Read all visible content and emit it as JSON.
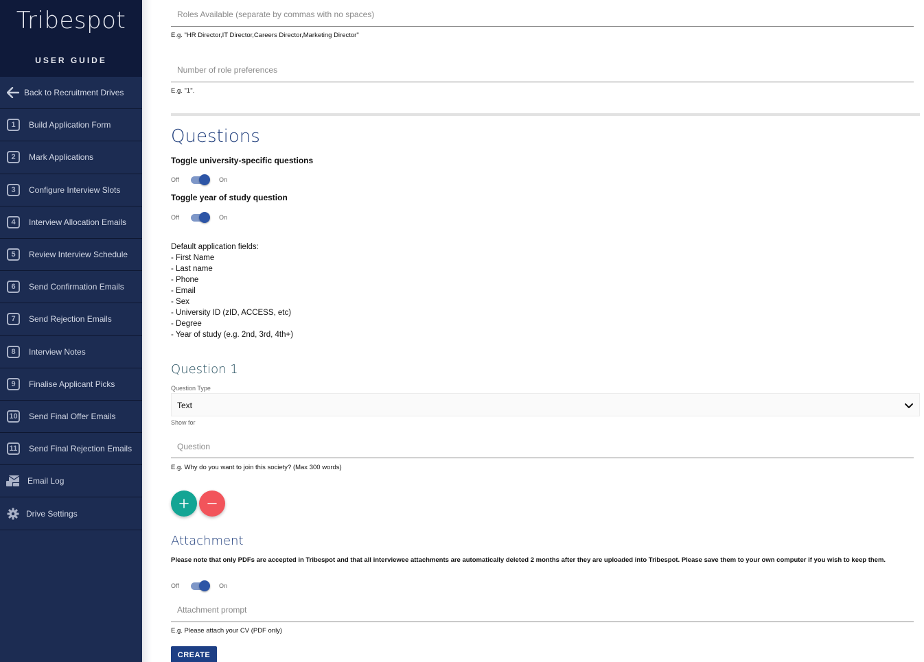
{
  "sidebar": {
    "logo": "Tribespot",
    "subtitle": "USER GUIDE",
    "back_label": "Back to Recruitment Drives",
    "items": [
      {
        "num": "1",
        "label": "Build Application Form"
      },
      {
        "num": "2",
        "label": "Mark Applications"
      },
      {
        "num": "3",
        "label": "Configure Interview Slots"
      },
      {
        "num": "4",
        "label": "Interview Allocation Emails"
      },
      {
        "num": "5",
        "label": "Review Interview Schedule"
      },
      {
        "num": "6",
        "label": "Send Confirmation Emails"
      },
      {
        "num": "7",
        "label": "Send Rejection Emails"
      },
      {
        "num": "8",
        "label": "Interview Notes"
      },
      {
        "num": "9",
        "label": "Finalise Applicant Picks"
      },
      {
        "num": "10",
        "label": "Send Final Offer Emails"
      },
      {
        "num": "11",
        "label": "Send Final Rejection Emails"
      }
    ],
    "email_log_label": "Email Log",
    "drive_settings_label": "Drive Settings"
  },
  "form": {
    "roles": {
      "placeholder": "Roles Available (separate by commas with no spaces)",
      "hint": "E.g. \"HR Director,IT Director,Careers Director,Marketing Director\""
    },
    "role_prefs": {
      "placeholder": "Number of role preferences",
      "hint": "E.g. \"1\"."
    }
  },
  "questions": {
    "heading": "Questions",
    "toggle_university_label": "Toggle university-specific questions",
    "toggle_year_label": "Toggle year of study question",
    "off_label": "Off",
    "on_label": "On",
    "defaults_title": "Default application fields:",
    "defaults": [
      "- First Name",
      "- Last name",
      "- Phone",
      "- Email",
      "- Sex",
      "- University ID (zID, ACCESS, etc)",
      "- Degree",
      "- Year of study (e.g. 2nd, 3rd, 4th+)"
    ],
    "toggle_university_on": true,
    "toggle_year_on": true
  },
  "question1": {
    "heading": "Question 1",
    "type_label": "Question Type",
    "type_value": "Text",
    "show_for_label": "Show for",
    "question_placeholder": "Question",
    "question_hint": "E.g. Why do you want to join this society? (Max 300 words)"
  },
  "attachment": {
    "heading": "Attachment",
    "note": "Please note that only PDFs are accepted in Tribespot and that all interviewee attachments are automatically deleted 2 months after they are uploaded into Tribespot. Please save them to your own computer if you wish to keep them.",
    "off_label": "Off",
    "on_label": "On",
    "toggle_on": true,
    "prompt_placeholder": "Attachment prompt",
    "prompt_hint": "E.g. Please attach your CV (PDF only)"
  },
  "create_label": "CREATE",
  "colors": {
    "sidebar_bg": "#1c2c52",
    "logo_bg": "#0f1a3a",
    "heading": "#1c3b7a",
    "add_button": "#13a594",
    "remove_button": "#f2545b",
    "toggle_knob": "#2d55a6",
    "create_button": "#1d3f85"
  }
}
